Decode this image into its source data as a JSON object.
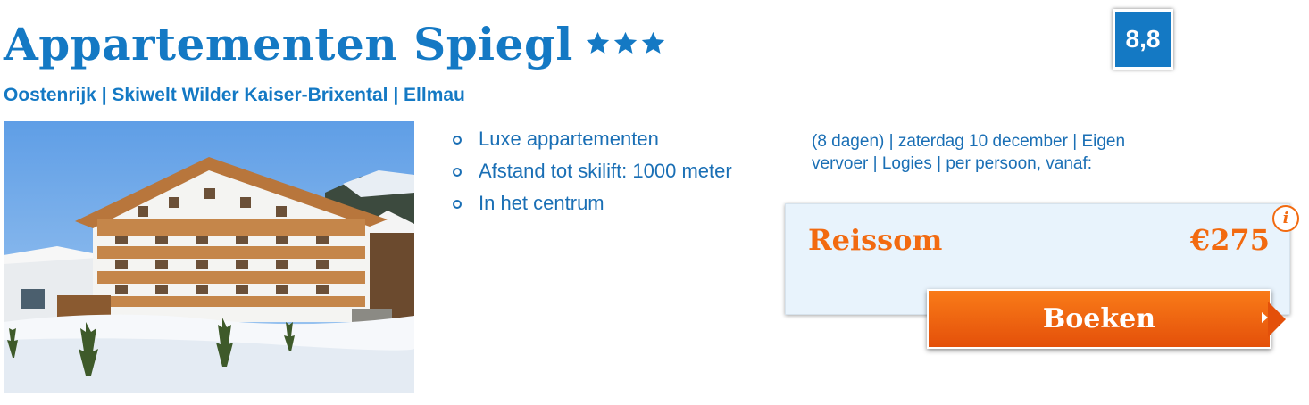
{
  "header": {
    "title": "Appartementen Spiegl",
    "stars": 3,
    "rating": "8,8",
    "location": "Oostenrijk | Skiwelt Wilder Kaiser-Brixental | Ellmau"
  },
  "features": [
    "Luxe appartementen",
    "Afstand tot skilift: 1000 meter",
    "In het centrum"
  ],
  "offer": {
    "details": "(8 dagen) | zaterdag 10 december | Eigen vervoer | Logies | per persoon, vanaf:",
    "price_label": "Reissom",
    "price": "€275",
    "info_icon": "i",
    "book_label": "Boeken"
  },
  "colors": {
    "brand_blue": "#1479c4",
    "accent_orange": "#f26a10",
    "price_box_bg": "#e8f3fc"
  },
  "icons": [
    "star-icon",
    "info-icon",
    "chevron-right-icon"
  ]
}
